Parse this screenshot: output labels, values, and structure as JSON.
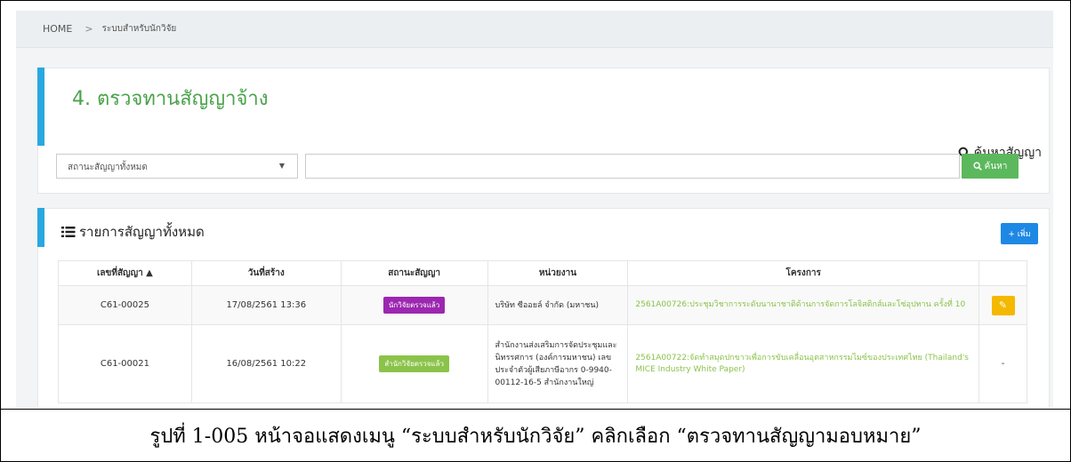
{
  "breadcrumb": {
    "home": "HOME",
    "separator": ">",
    "current": "ระบบสำหรับนักวิจัย"
  },
  "header": {
    "title": "4. ตรวจทานสัญญาจ้าง",
    "search_contract_label": "ค้นหาสัญญา"
  },
  "filter": {
    "status_selected": "สถานะสัญญาทั้งหมด",
    "search_value": "",
    "search_button": "ค้นหา"
  },
  "list": {
    "title": "รายการสัญญาทั้งหมด",
    "add_button": "+ เพิ่ม",
    "columns": [
      "เลขที่สัญญา ▲",
      "วันที่สร้าง",
      "สถานะสัญญา",
      "หน่วยงาน",
      "โครงการ",
      ""
    ],
    "rows": [
      {
        "contract_no": "C61-00025",
        "created": "17/08/2561 13:36",
        "status": "นักวิจัยตรวจแล้ว",
        "status_color": "#9c27b0",
        "unit": "บริษัท ซีออยล์ จำกัด (มหาชน)",
        "project": "2561A00726:ประชุมวิชาการระดับนานาชาติด้านการจัดการโลจิสติกส์และโซ่อุปทาน ครั้งที่ 10",
        "action": "edit-icon"
      },
      {
        "contract_no": "C61-00021",
        "created": "16/08/2561 10:22",
        "status": "สำนักวิจัยตรวจแล้ว",
        "status_color": "#8bc34a",
        "unit": "สำนักงานส่งเสริมการจัดประชุมและนิทรรศการ (องค์การมหาชน) เลขประจำตัวผู้เสียภาษีอากร 0-9940-00112-16-5 สำนักงานใหญ่",
        "project": "2561A00722:จัดทำสมุดปกขาวเพื่อการขับเคลื่อนอุตสาหกรรมไมซ์ของประเทศไทย (Thailand's MICE Industry White Paper)",
        "action": "-"
      }
    ]
  },
  "caption": "รูปที่ 1-005 หน้าจอแสดงเมนู “ระบบสำหรับนักวิจัย” คลิกเลือก “ตรวจทานสัญญามอบหมาย”",
  "colors": {
    "accent": "#29a8e0",
    "title_green": "#4aa34a",
    "search_green": "#5cb85c",
    "add_blue": "#1e88e5",
    "edit_yellow": "#f5b800"
  }
}
